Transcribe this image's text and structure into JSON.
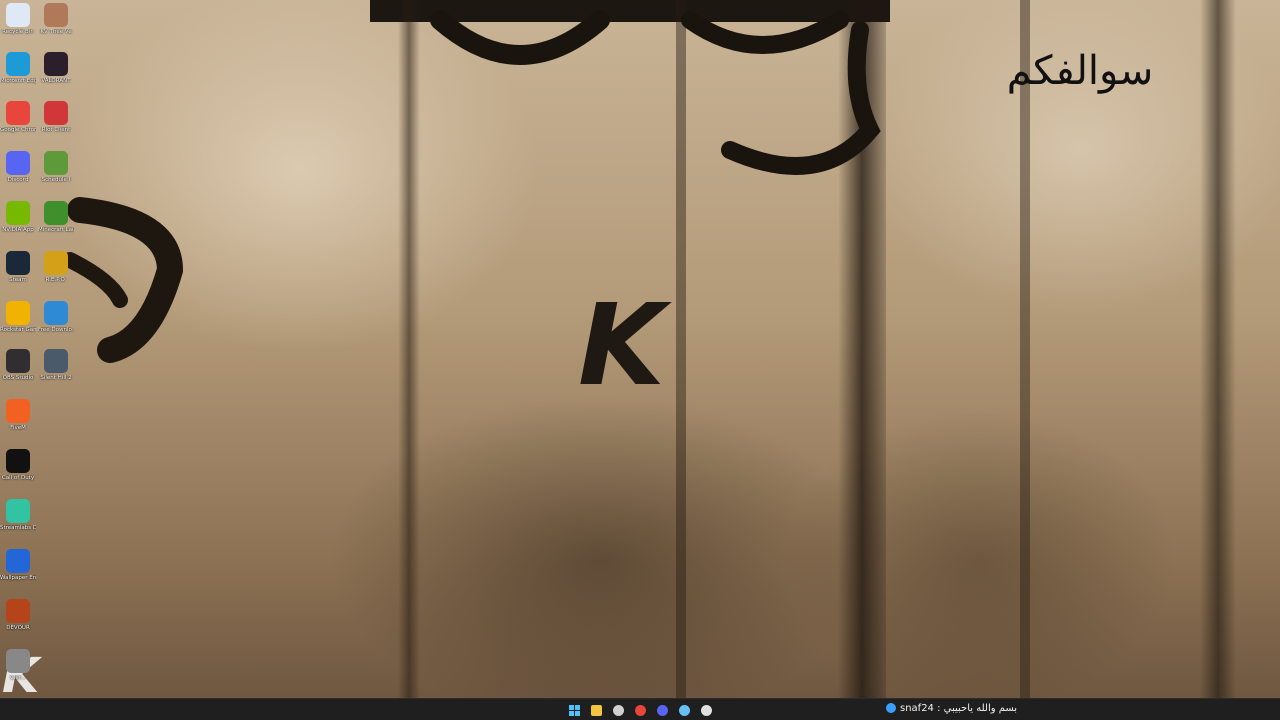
{
  "wallpaper": {
    "calligraphy_text": "سوالفكم",
    "logo_letter": "K",
    "corner_logo_letter": "K"
  },
  "desktop_icons": [
    {
      "label": "Recycle Bin",
      "icon": "recycle-bin-icon",
      "color": "#dfe9f5"
    },
    {
      "label": "KV Thee Ve",
      "icon": "user-avatar-icon",
      "color": "#b07a5a"
    },
    {
      "label": "Microsoft Edge",
      "icon": "edge-icon",
      "color": "#1e9bd7"
    },
    {
      "label": "VALORANT",
      "icon": "valorant-icon",
      "color": "#2b1f2b"
    },
    {
      "label": "Google Chrome",
      "icon": "chrome-icon",
      "color": "#e8453c"
    },
    {
      "label": "Riot Client",
      "icon": "riot-client-icon",
      "color": "#d13639"
    },
    {
      "label": "Discord",
      "icon": "discord-icon",
      "color": "#5865f2"
    },
    {
      "label": "Schedule I",
      "icon": "schedule-i-icon",
      "color": "#5e9a3a"
    },
    {
      "label": "NVIDIA App",
      "icon": "nvidia-icon",
      "color": "#76b900"
    },
    {
      "label": "Minecraft Launcher",
      "icon": "minecraft-icon",
      "color": "#3f8f2c"
    },
    {
      "label": "Steam",
      "icon": "steam-icon",
      "color": "#1b2838"
    },
    {
      "label": "R.E.P.O.",
      "icon": "repo-icon",
      "color": "#d4a017"
    },
    {
      "label": "Rockstar Games",
      "icon": "rockstar-icon",
      "color": "#f2b300"
    },
    {
      "label": "Free Downlo...",
      "icon": "free-download-icon",
      "color": "#2f8ad6"
    },
    {
      "label": "OBS Studio",
      "icon": "obs-icon",
      "color": "#302e31"
    },
    {
      "label": "Silent Hill 2",
      "icon": "silent-hill-icon",
      "color": "#4a5a6a"
    },
    {
      "label": "FiveM",
      "icon": "fivem-icon",
      "color": "#f26122"
    },
    {
      "label": "Call of Duty",
      "icon": "call-of-duty-icon",
      "color": "#111111"
    },
    {
      "label": "Streamlabs Desktop",
      "icon": "streamlabs-icon",
      "color": "#31c3a2"
    },
    {
      "label": "Wallpaper Engine",
      "icon": "wallpaper-engine-icon",
      "color": "#2266d8"
    },
    {
      "label": "DEVOUR",
      "icon": "devour-icon",
      "color": "#b5441a"
    },
    {
      "label": "Clar...",
      "icon": "clarity-icon",
      "color": "#888888"
    }
  ],
  "taskbar": {
    "apps": [
      {
        "name": "start",
        "icon": "windows-start-icon",
        "color": "#4cc2ff"
      },
      {
        "name": "file-explorer",
        "icon": "folder-icon",
        "color": "#f4c542"
      },
      {
        "name": "settings",
        "icon": "gear-icon",
        "color": "#d0d0d0"
      },
      {
        "name": "chrome",
        "icon": "chrome-icon",
        "color": "#e8453c"
      },
      {
        "name": "discord",
        "icon": "discord-icon",
        "color": "#5865f2"
      },
      {
        "name": "steam",
        "icon": "steam-icon",
        "color": "#66c0f4"
      },
      {
        "name": "obs",
        "icon": "obs-icon",
        "color": "#e0e0e0"
      }
    ],
    "tray_text": "بسم والله ياحبيبي : snaf24"
  }
}
